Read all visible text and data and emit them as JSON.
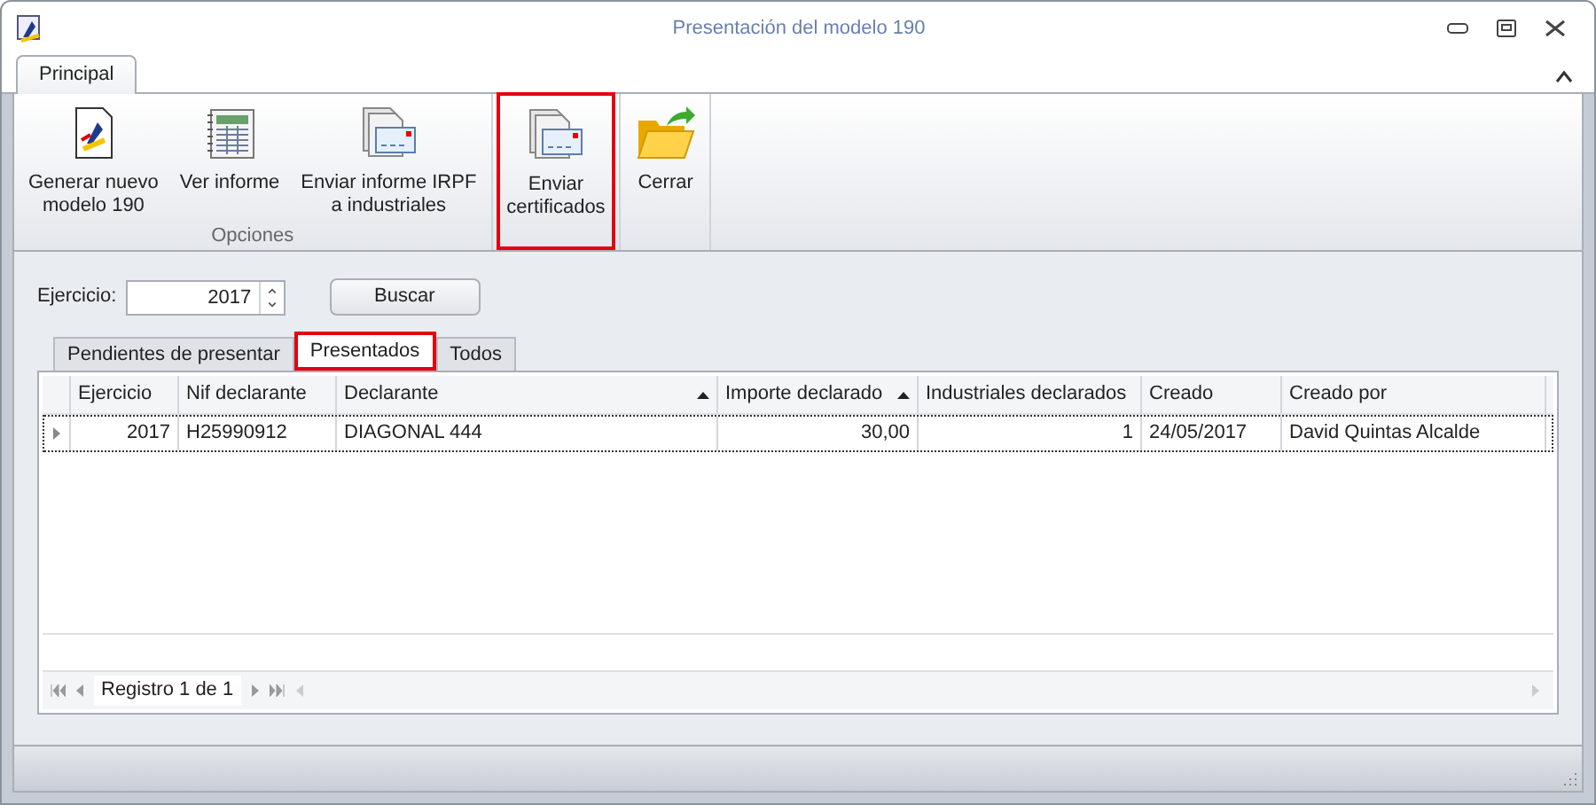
{
  "window": {
    "title": "Presentación del modelo 190"
  },
  "ribbon": {
    "tabs": [
      {
        "label": "Principal",
        "selected": true
      }
    ],
    "groups": [
      {
        "label": "Opciones",
        "buttons": [
          {
            "label": "Generar nuevo\nmodelo 190",
            "kind": "document",
            "highlighted": false
          },
          {
            "label": "Ver informe",
            "kind": "report",
            "highlighted": false
          },
          {
            "label": "Enviar informe IRPF\na industriales",
            "kind": "mail",
            "highlighted": false
          }
        ]
      },
      {
        "buttons": [
          {
            "label": "Enviar\ncertificados",
            "kind": "mail",
            "highlighted": true
          }
        ]
      },
      {
        "buttons": [
          {
            "label": "Cerrar",
            "kind": "folder",
            "highlighted": false
          }
        ]
      }
    ]
  },
  "filter": {
    "label": "Ejercicio:",
    "value": "2017",
    "button": "Buscar"
  },
  "tabs": [
    {
      "label": "Pendientes de presentar",
      "selected": false,
      "highlighted": false
    },
    {
      "label": "Presentados",
      "selected": true,
      "highlighted": true
    },
    {
      "label": "Todos",
      "selected": false,
      "highlighted": false
    }
  ],
  "table": {
    "columns": [
      {
        "label": "Ejercicio",
        "kind": "number",
        "sorted": false
      },
      {
        "label": "Nif declarante",
        "kind": "text",
        "sorted": false
      },
      {
        "label": "Declarante",
        "kind": "text",
        "sorted": true
      },
      {
        "label": "Importe declarado",
        "kind": "number",
        "sorted": true
      },
      {
        "label": "Industriales declarados",
        "kind": "number",
        "sorted": false
      },
      {
        "label": "Creado",
        "kind": "text",
        "sorted": false
      },
      {
        "label": "Creado por",
        "kind": "text",
        "sorted": false
      }
    ],
    "rows": [
      {
        "selected": true,
        "cells": [
          "2017",
          "H25990912",
          "DIAGONAL 444",
          "30,00",
          "1",
          "24/05/2017",
          "David Quintas Alcalde"
        ]
      }
    ]
  },
  "navigator": {
    "text": "Registro 1 de 1"
  }
}
